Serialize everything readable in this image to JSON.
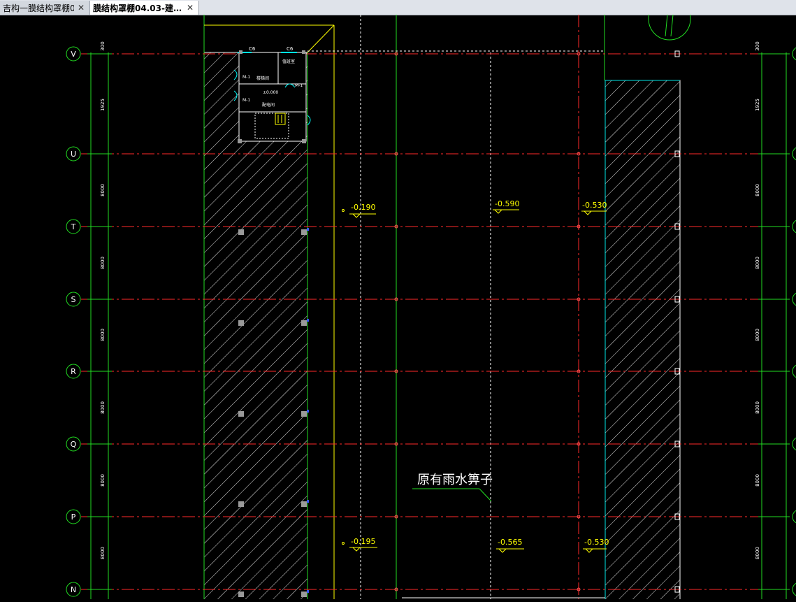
{
  "tabs": [
    {
      "title": "吉构一膜结构罩棚0…",
      "active": false,
      "close": "✕"
    },
    {
      "title": "膜结构罩棚04.03-建…",
      "active": true,
      "close": "✕"
    }
  ],
  "grid": {
    "rows": [
      "V",
      "U",
      "T",
      "S",
      "R",
      "Q",
      "P",
      "N"
    ],
    "left_dims": [
      "300",
      "1925",
      "8000",
      "8000",
      "8000",
      "8000",
      "8000",
      "8000"
    ],
    "right_dims": [
      "300",
      "1925",
      "8000",
      "8000",
      "8000",
      "8000",
      "8000",
      "8000"
    ]
  },
  "elevations": [
    "-0.190",
    "-0.590",
    "-0.530",
    "-0.195",
    "-0.565",
    "-0.530"
  ],
  "annotation": "原有雨水箅子",
  "room": {
    "labels": [
      "C6",
      "C6",
      "楼梯间",
      "值班室",
      "配电间",
      "±0.000",
      "M-1",
      "M-1",
      "M-1"
    ]
  },
  "colors": {
    "background": "#000000",
    "axis_red": "#ff2a2a",
    "green": "#22dd22",
    "yellow": "#ffff00",
    "white": "#ffffff",
    "cyan": "#00ffff"
  }
}
